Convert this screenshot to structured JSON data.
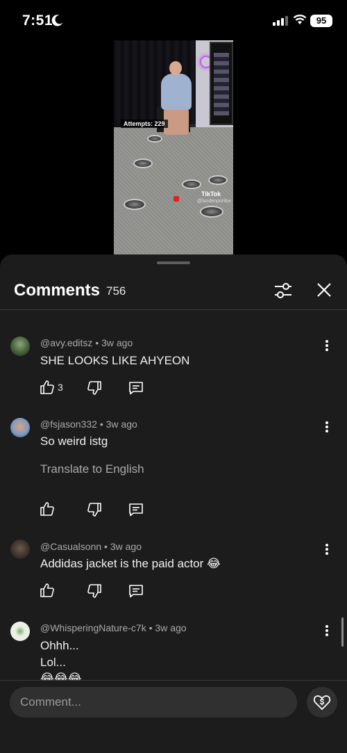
{
  "status_bar": {
    "time": "7:51",
    "battery": "95"
  },
  "video": {
    "attempts_label": "Attempts: 229",
    "watermark": "TikTok",
    "watermark_user": "@landenporitov"
  },
  "comments_sheet": {
    "title": "Comments",
    "count": "756",
    "comments": [
      {
        "author": "@avy.editsz",
        "time": "3w ago",
        "text": "SHE LOOKS LIKE AHYEON",
        "likes": "3"
      },
      {
        "author": "@fsjason332",
        "time": "3w ago",
        "text": "So weird istg",
        "translate": "Translate to English"
      },
      {
        "author": "@Casualsonn",
        "time": "3w ago",
        "text": "Addidas jacket is the paid actor 😂"
      },
      {
        "author": "@WhisperingNature-c7k",
        "time": "3w ago",
        "text_line1": "Ohhh...",
        "text_line2": "Lol...",
        "text_line3": "😂😂😂"
      }
    ],
    "separator": "•"
  },
  "comment_bar": {
    "placeholder": "Comment..."
  },
  "colors": {
    "background": "#000000",
    "sheet": "#1c1c1c",
    "input": "#303030",
    "muted_text": "#aaaaaa"
  }
}
